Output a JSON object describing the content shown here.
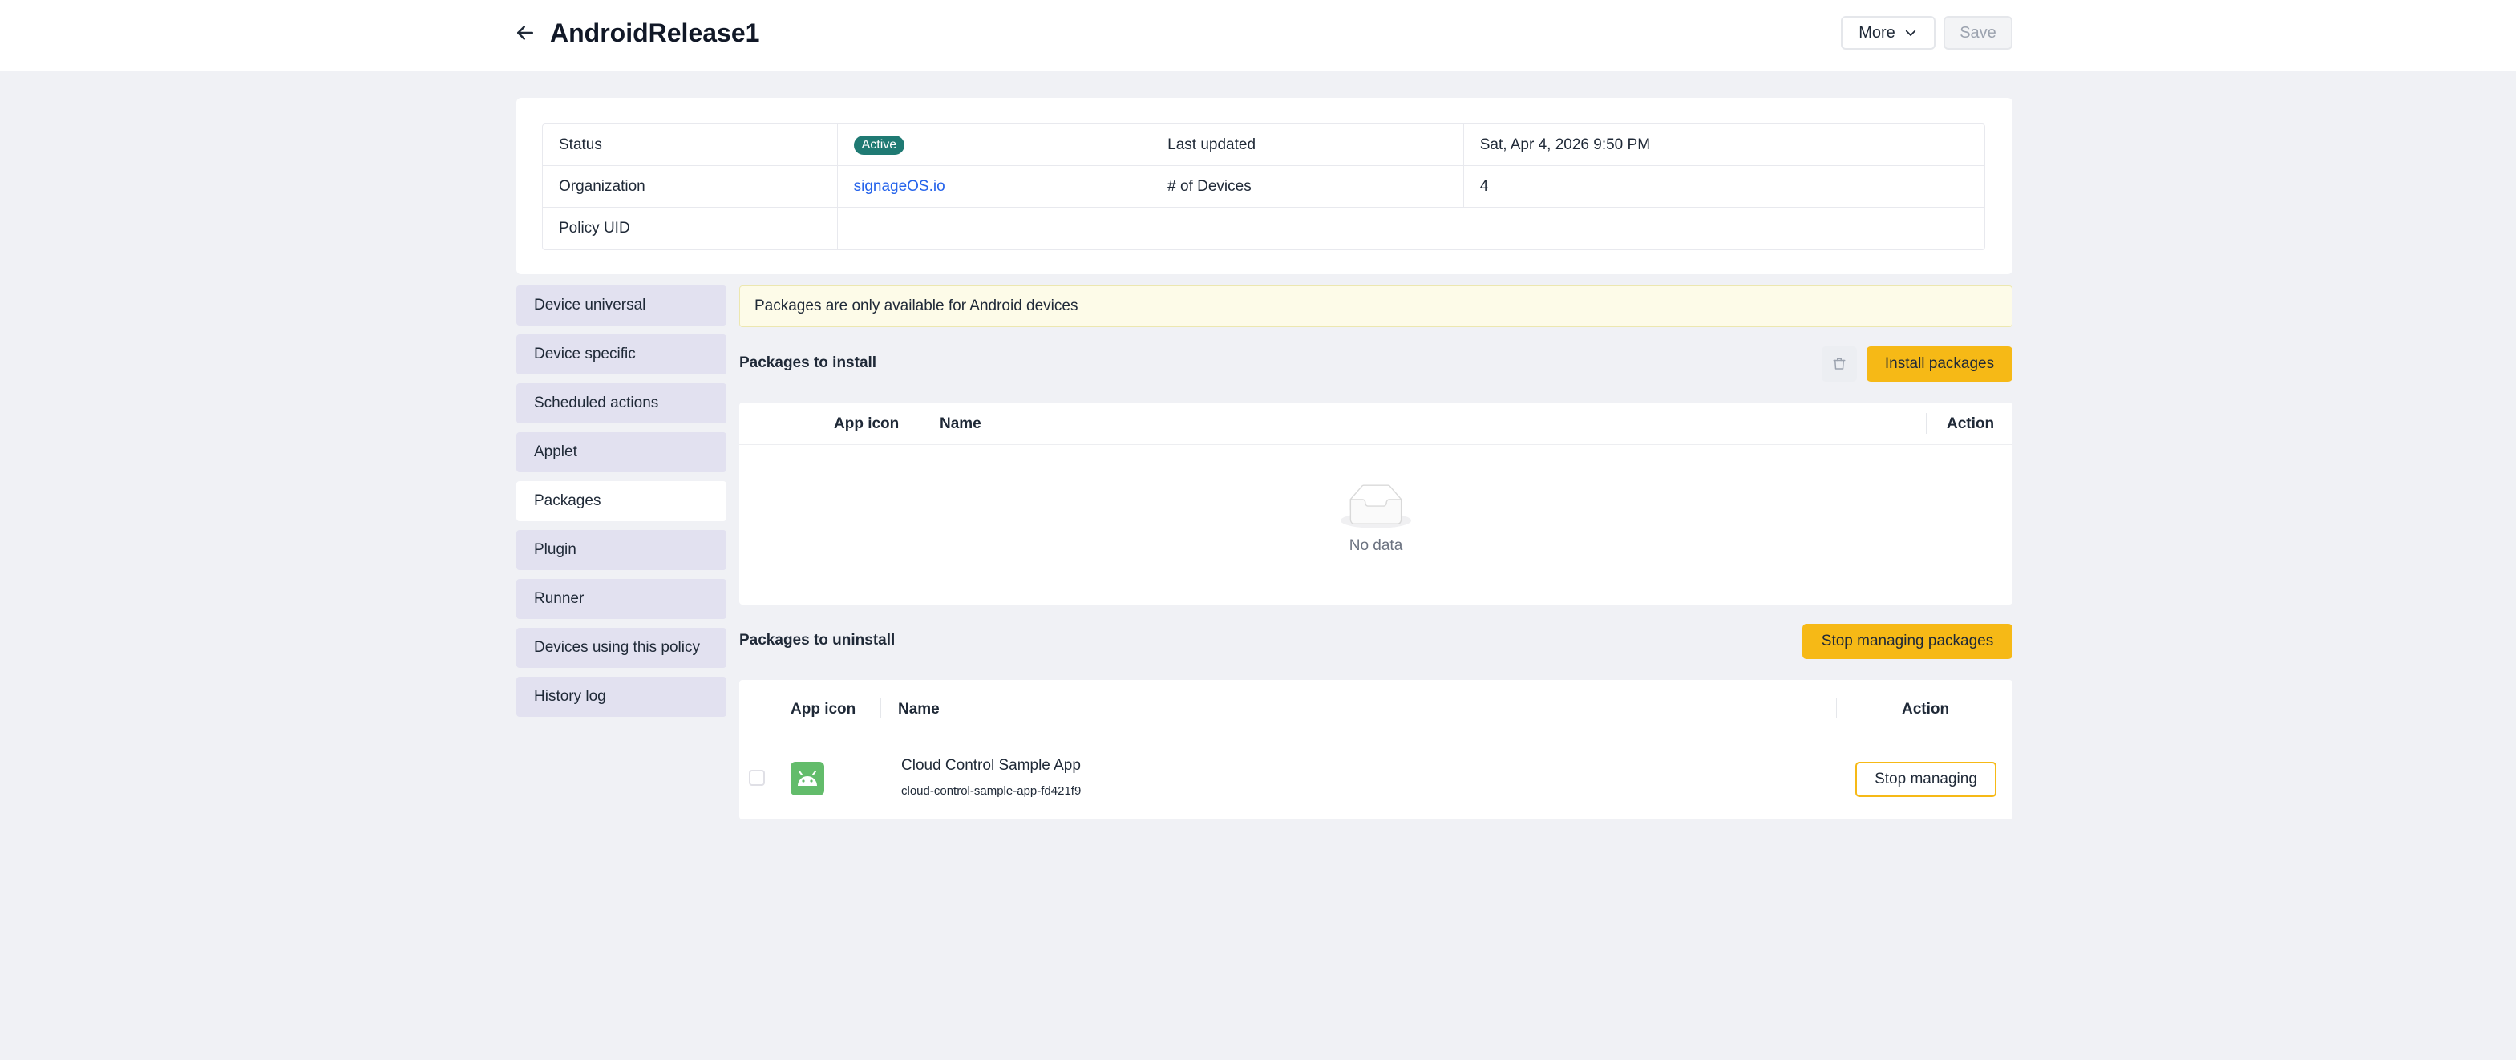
{
  "header": {
    "title": "AndroidRelease1",
    "more_label": "More",
    "save_label": "Save"
  },
  "info": {
    "status_label": "Status",
    "status_value": "Active",
    "last_updated_label": "Last updated",
    "last_updated_value": "Sat, Apr 4, 2026 9:50 PM",
    "organization_label": "Organization",
    "organization_value": "signageOS.io",
    "devices_label": "# of Devices",
    "devices_value": "4",
    "policy_uid_label": "Policy UID",
    "policy_uid_value": ""
  },
  "sidebar": {
    "items": [
      {
        "label": "Device universal"
      },
      {
        "label": "Device specific"
      },
      {
        "label": "Scheduled actions"
      },
      {
        "label": "Applet"
      },
      {
        "label": "Packages",
        "active": true
      },
      {
        "label": "Plugin"
      },
      {
        "label": "Runner"
      },
      {
        "label": "Devices using this policy"
      },
      {
        "label": "History log"
      }
    ]
  },
  "main": {
    "notice": "Packages are only available for Android devices",
    "install": {
      "title": "Packages to install",
      "button": "Install packages",
      "columns": {
        "icon": "App icon",
        "name": "Name",
        "action": "Action"
      },
      "empty_text": "No data"
    },
    "uninstall": {
      "title": "Packages to uninstall",
      "button": "Stop managing packages",
      "columns": {
        "icon": "App icon",
        "name": "Name",
        "action": "Action"
      },
      "rows": [
        {
          "name": "Cloud Control Sample App",
          "package": "cloud-control-sample-app-fd421f9",
          "action": "Stop managing"
        }
      ]
    }
  },
  "colors": {
    "accent": "#f6b916",
    "status_active": "#1f7a73",
    "link": "#2563eb",
    "android_icon": "#63bc6b"
  },
  "icons": [
    "arrow-left-icon",
    "chevron-down-icon",
    "trash-icon",
    "inbox-empty-icon",
    "android-icon"
  ]
}
